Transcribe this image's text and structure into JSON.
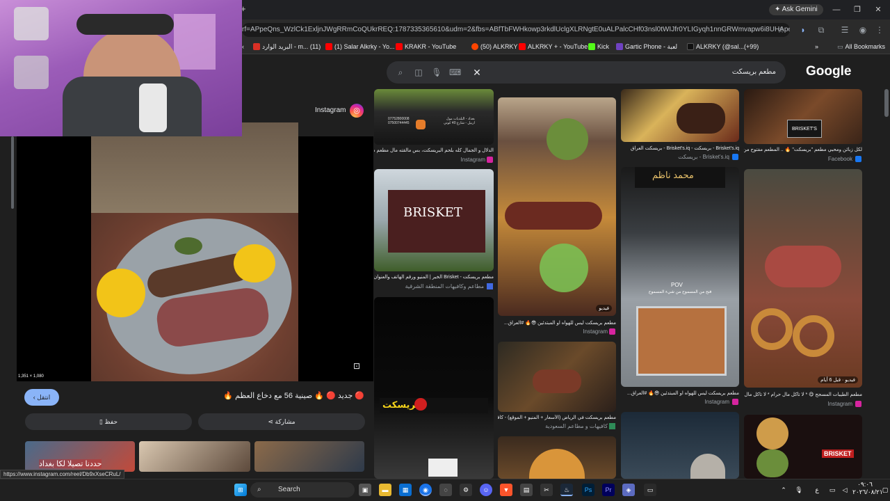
{
  "browser": {
    "url": "rf=APpeQns_WzlCk1ExljnJWgRRmCoQUkrREQ:1787335365610&udm=2&fbs=ABfTbFWHkowp3rkdlUclgXLRNgtE0uALPalcCHf03nsl0tWIJfr0YLIGyqh1nnGRWmvapw6i8UHApew3iXEJXR...",
    "ask_gemini": "Ask Gemini",
    "bookmarks": [
      {
        "label": "البريد الوارد - m... (11)",
        "color": "#d93025"
      },
      {
        "label": "(1) Salar Alkrky - Yo...",
        "color": "#ff0000"
      },
      {
        "label": "KRAKR - YouTube",
        "color": "#ff0000"
      },
      {
        "label": "(50) ALKRKY",
        "color": "#ff4500"
      },
      {
        "label": "ALKRKY + - YouTube",
        "color": "#ff0000"
      },
      {
        "label": "Kick",
        "color": "#53fc18"
      },
      {
        "label": "Gartic Phone - لعبة",
        "color": "#6f42c1"
      },
      {
        "label": "ALKRKY (@sal...(+99)",
        "color": "#111111"
      }
    ],
    "all_bookmarks": "All Bookmarks"
  },
  "google": {
    "logo": "Google",
    "query": "مطعم بريسكت"
  },
  "preview": {
    "source": "Instagram",
    "dimensions": "1,351 × 1,080",
    "title": "🔴 جديد 🔴 🔥 صينية 56 مع دخاع العظم 🔥",
    "visit_label": "انتقل",
    "share_label": "مشاركة",
    "save_label": "حفظ",
    "thumb_text": "حددنا تصيلا لكا بغداد"
  },
  "results": {
    "col1": [
      {
        "caption": "الدلال و الجمال كله بلحم البريسكت، بس مالقته مال مطعم ميت...",
        "source": "Instagram",
        "shop_text": "بغداد - البلديات مول\nاربيل - شارع 40 كوتي",
        "phone": "07752800008\n07500744445"
      },
      {
        "caption": "مطعم بريسكت - Brisket الخبر | المنيو ورقم الهاتف والعنوان",
        "source": "مطاعم وكافيهات المنطقة الشرقية",
        "sign": "BRISKET"
      },
      {
        "caption": "",
        "source": "",
        "sign": "بريسكت"
      }
    ],
    "col2": [
      {
        "caption": "مطعم بريسكت ليس للهواه او المبتدئين 😎🔥 #العراق...",
        "source": "Instagram",
        "badge": "فيديو"
      },
      {
        "caption": "مطعم بريسكت في الرياض (الأسعار + المنيو + الموقع) - كافيه...",
        "source": "كافيهات و مطاعم السعودية"
      },
      {
        "caption": "",
        "source": ""
      }
    ],
    "col3": [
      {
        "caption": "Brisket's.iq - بريسكت - Brisket's.iq - بريسكت العراق",
        "source": "Brisket's.iq - بريسكت"
      },
      {
        "caption": "مطعم بريسكت ليس للهواه او المبتدئين 😎🔥 #العراق...",
        "source": "Instagram",
        "sign": "محمد ناظم",
        "overlay": "فتح من المسموح من شيء المسموح",
        "pov": "POV"
      },
      {
        "caption": "",
        "source": ""
      }
    ],
    "col4": [
      {
        "caption": "لكل زبائن ومحبي مطعم \"بريسكت\" 🔥 .. المطعم مفتوح من...",
        "source": "Facebook",
        "sign": "BRISKET'S"
      },
      {
        "caption": "مطعم الطيبات المسجح 😋 * لا تأكل مال حرام * لا تأكل مال...",
        "source": "Instagram",
        "badge": "فيديو · قبل 6 أيام"
      },
      {
        "caption": "",
        "source": "",
        "sign": "BRISKET"
      }
    ]
  },
  "statusbar": {
    "url": "https://www.instagram.com/reel/Db9xXseCRuL/"
  },
  "taskbar": {
    "search": "Search",
    "time": "٠٩:٠٦",
    "date": "٢٠٢٦/٠٨/٢١",
    "lang": "ع"
  }
}
